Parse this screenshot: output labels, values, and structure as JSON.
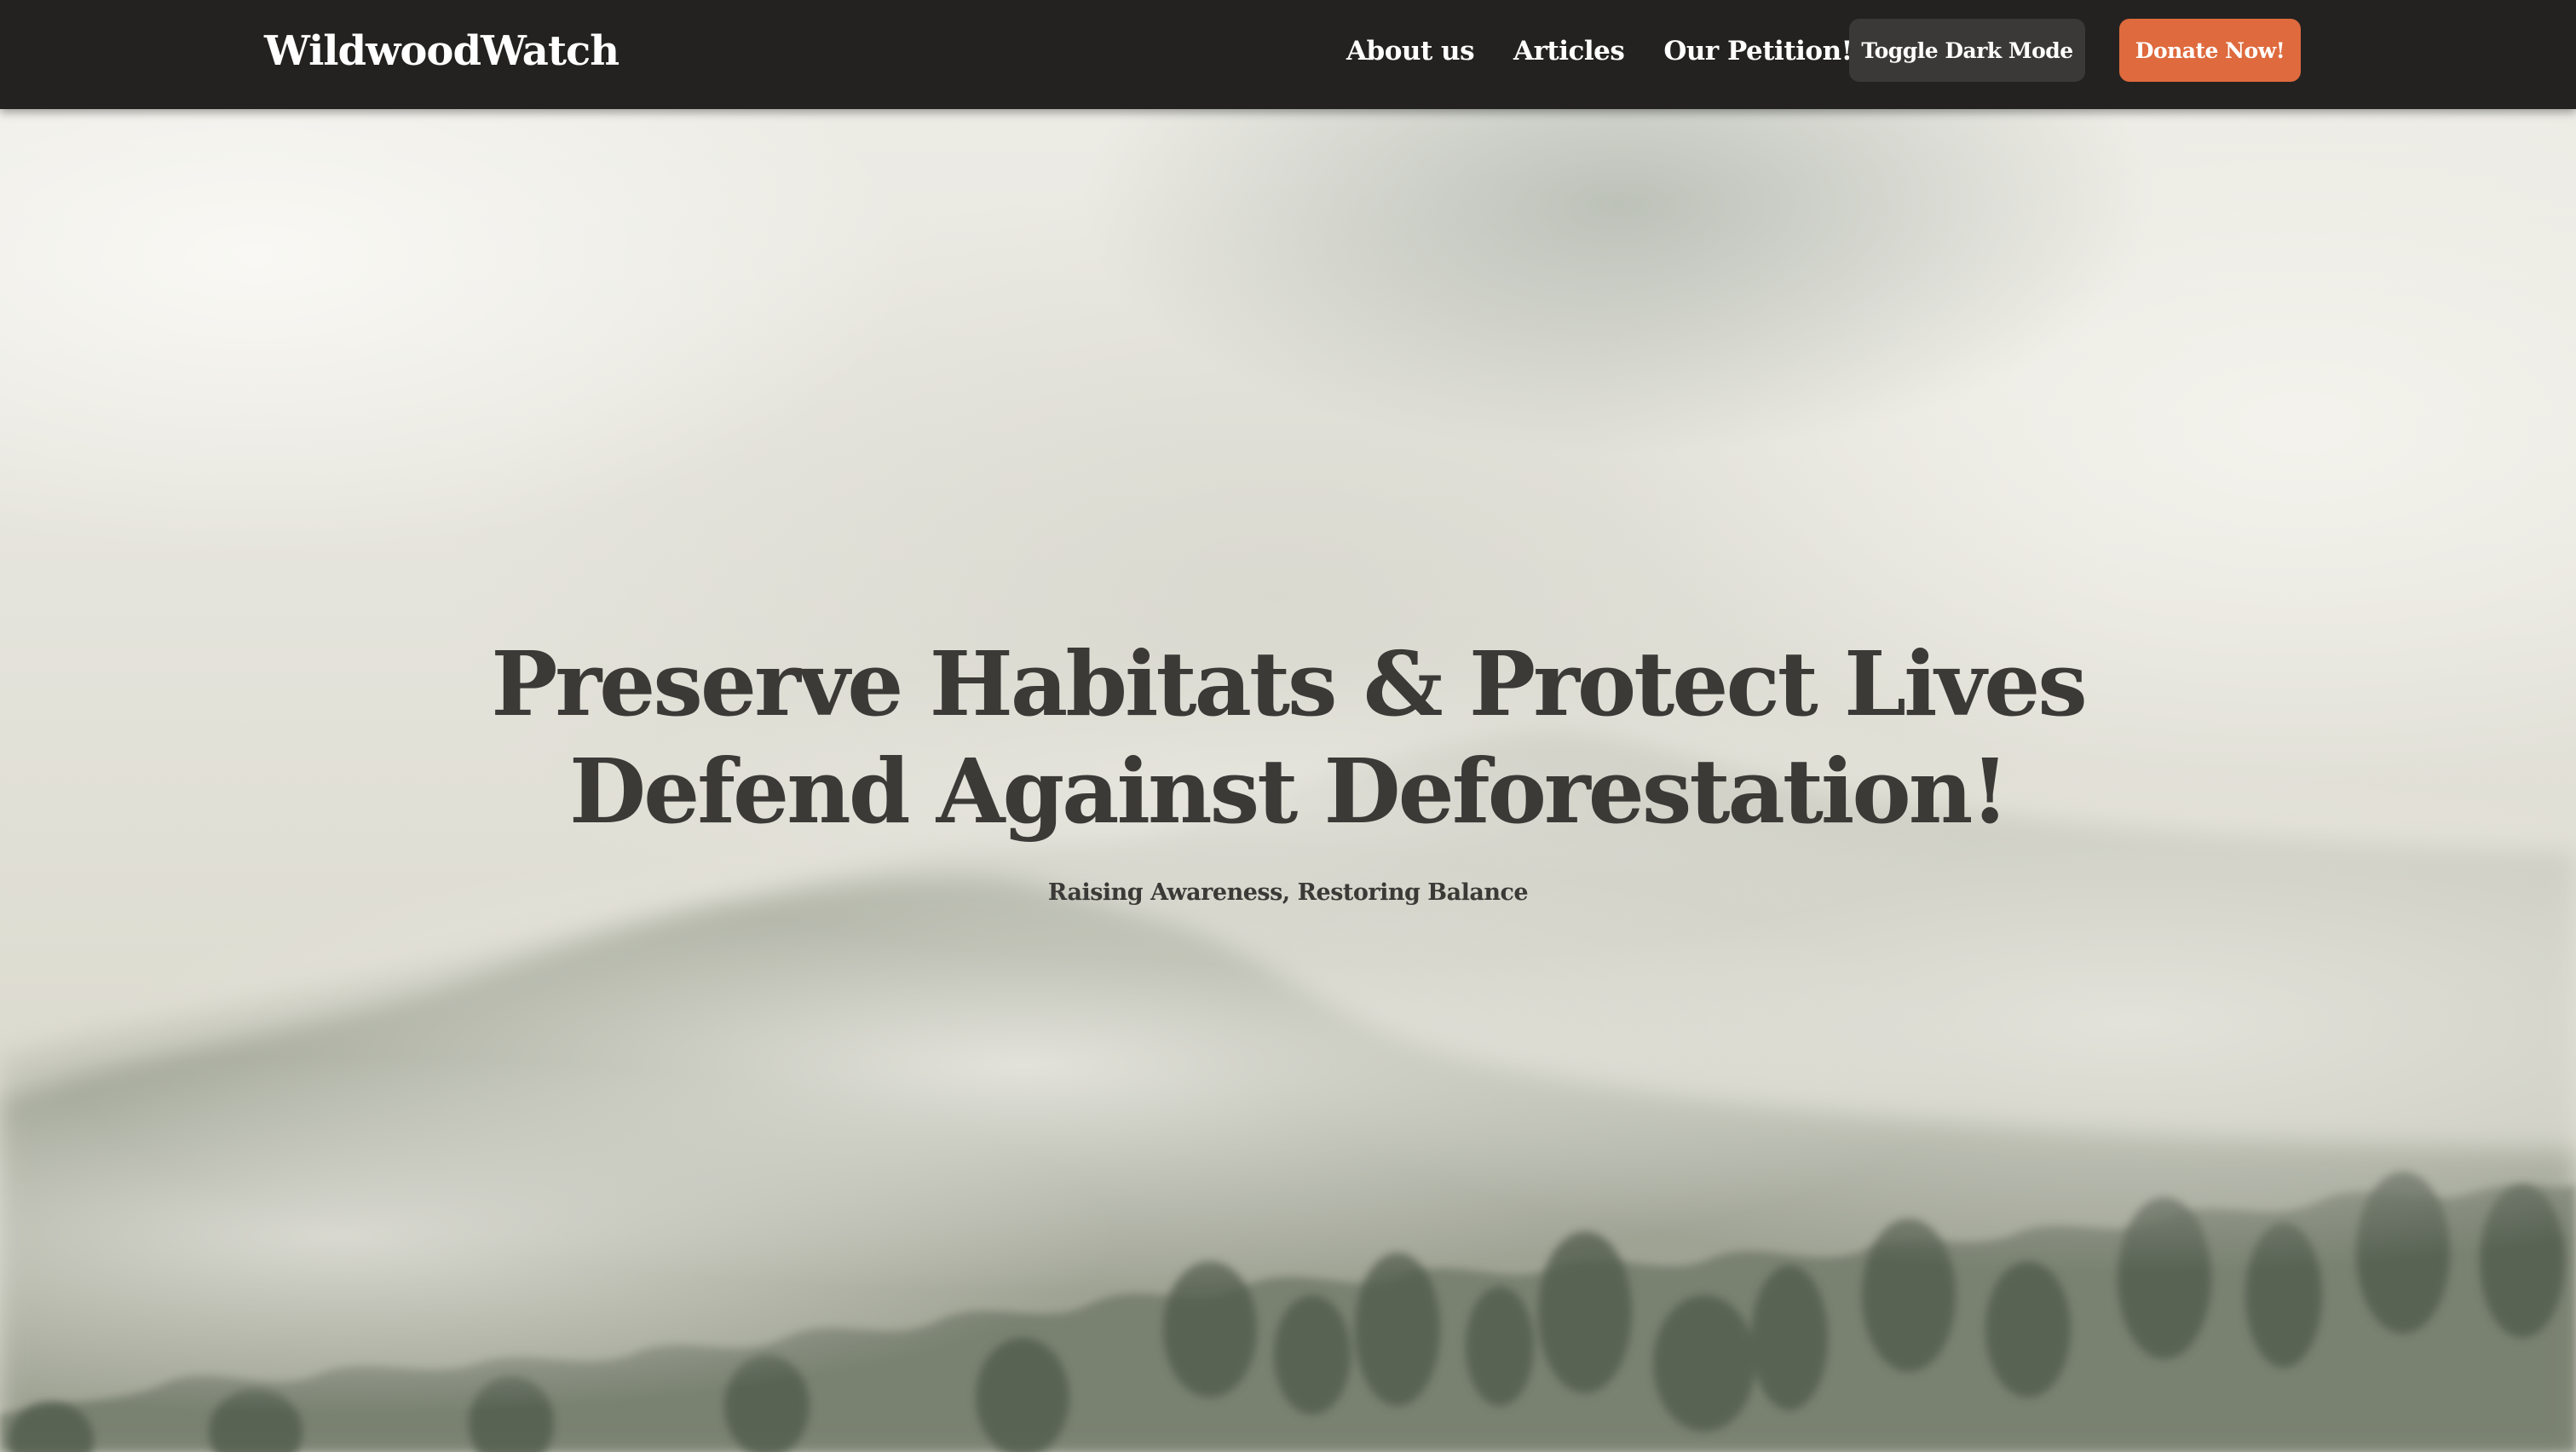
{
  "navbar": {
    "brand": "WildwoodWatch",
    "links": [
      {
        "label": "About us"
      },
      {
        "label": "Articles"
      },
      {
        "label": "Our Petition!"
      }
    ],
    "toggle_dark_mode_label": "Toggle Dark Mode",
    "donate_label": "Donate Now!"
  },
  "hero": {
    "title": "Preserve Habitats & Protect Lives Defend Against Deforestation!",
    "subtitle": "Raising Awareness, Restoring Balance",
    "background": "misty forested mountains"
  },
  "colors": {
    "navbar_bg": "#232220",
    "toggle_button_bg": "#3a3937",
    "donate_button_bg": "#de6a3d",
    "hero_text": "#3b3a37"
  }
}
